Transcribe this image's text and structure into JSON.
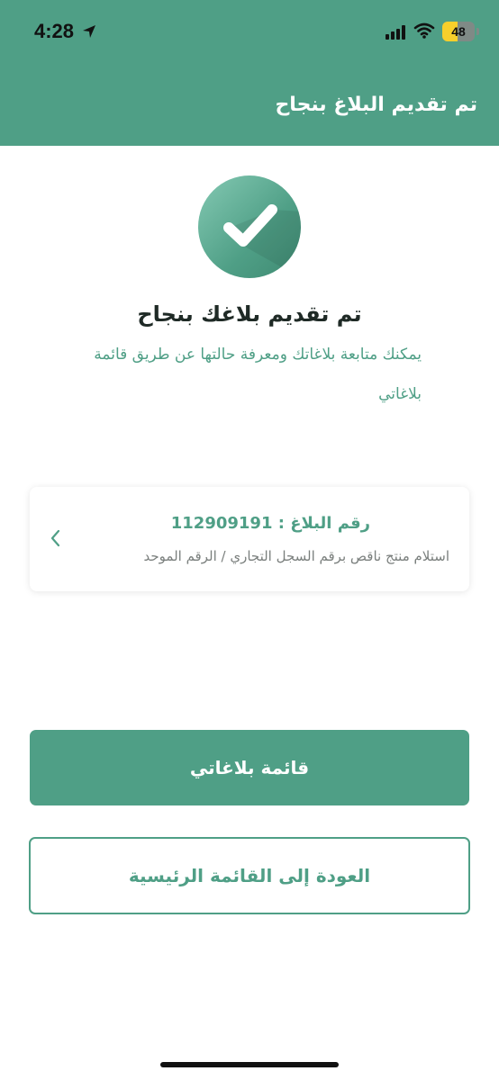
{
  "status_bar": {
    "time": "4:28",
    "battery_level": "48",
    "battery_fraction": 0.48,
    "icons": [
      "location-arrow-icon",
      "signal-icon",
      "wifi-icon",
      "battery-icon"
    ]
  },
  "header": {
    "title": "تم تقديم البلاغ بنجاح"
  },
  "success": {
    "icon": "check-icon",
    "title": "تم تقديم بلاغك بنجاح",
    "message": "يمكنك متابعة بلاغاتك ومعرفة حالتها عن طريق قائمة بلاغاتي"
  },
  "report_card": {
    "number_line": "رقم البلاغ : 112909191",
    "description": "استلام منتج ناقص برقم السجل التجاري / الرقم الموحد",
    "chevron_icon": "chevron-left-icon"
  },
  "actions": {
    "primary_label": "قائمة بلاغاتي",
    "secondary_label": "العودة إلى القائمة الرئيسية"
  },
  "colors": {
    "brand": "#4f9f86",
    "text_dark": "#1f2a26",
    "text_muted": "#7a7f7d",
    "battery": "#f7cf2b"
  }
}
